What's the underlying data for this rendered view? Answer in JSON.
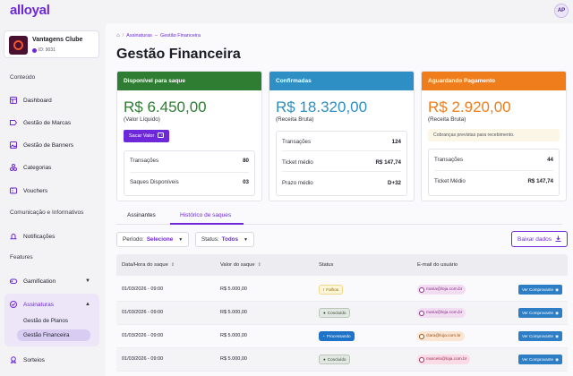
{
  "app": {
    "logo": "alloyal",
    "avatar_initials": "AP"
  },
  "club": {
    "name": "Vantagens Clube",
    "id": "ID: 9031"
  },
  "sidebar": {
    "sections": {
      "conteudo": "Conteúdo",
      "comunicacao": "Comunicação e Informativos",
      "features": "Features"
    },
    "items": [
      {
        "label": "Dashboard",
        "icon": "dashboard-icon"
      },
      {
        "label": "Gestão de Marcas",
        "icon": "tag-icon"
      },
      {
        "label": "Gestão de Banners",
        "icon": "image-icon"
      },
      {
        "label": "Categorias",
        "icon": "categories-icon"
      },
      {
        "label": "Vouchers",
        "icon": "voucher-icon"
      },
      {
        "label": "Notificações",
        "icon": "bell-icon"
      },
      {
        "label": "Gamification",
        "icon": "gamepad-icon"
      },
      {
        "label": "Assinaturas",
        "icon": "check-circle-icon"
      },
      {
        "label": "Sorteios",
        "icon": "award-icon"
      }
    ],
    "assinaturas_sub": [
      "Gestão de Planos",
      "Gestão Financeira"
    ]
  },
  "breadcrumb": {
    "parts": [
      "Assinaturas",
      "Gestão Financeira"
    ],
    "sep": "/",
    "inner_sep": "–"
  },
  "page_title": "Gestão Financeira",
  "cards": {
    "disponivel": {
      "title": "Disponível para saque",
      "amount": "R$ 6.450,00",
      "sub": "(Valor Líquido)",
      "button": "Sacar Valor",
      "rows": [
        {
          "label": "Transações",
          "value": "80"
        },
        {
          "label": "Saques Disponíveis",
          "value": "03"
        }
      ],
      "color": "#2e7d32"
    },
    "confirmadas": {
      "title": "Confirmadas",
      "amount": "R$ 18.320,00",
      "sub": "(Receita Bruta)",
      "rows": [
        {
          "label": "Transações",
          "value": "124"
        },
        {
          "label": "Ticket médio",
          "value": "R$ 147,74"
        },
        {
          "label": "Prazo médio",
          "value": "D+32"
        }
      ],
      "color": "#2d8fc4"
    },
    "aguardando": {
      "title": "Aguardando Pagamento",
      "amount": "R$ 2.920,00",
      "sub": "(Receita Bruta)",
      "notice": "Cobranças previstas para recebimento.",
      "rows": [
        {
          "label": "Transações",
          "value": "44"
        },
        {
          "label": "Ticket Médio",
          "value": "R$ 147,74"
        }
      ],
      "color": "#f07d1b"
    }
  },
  "tabs": [
    "Assinantes",
    "Histórico de saques"
  ],
  "filters": {
    "periodo": {
      "label": "Período:",
      "value": "Selecione"
    },
    "status": {
      "label": "Status:",
      "value": "Todos"
    },
    "download": "Baixar dados"
  },
  "table": {
    "headers": [
      "Data/Hora do saque",
      "Valor do saque",
      "Status",
      "E-mail do usuário"
    ],
    "rows": [
      {
        "date": "01/03/2026 - 09:00",
        "value": "R$ 5.000,00",
        "status": "Falhou",
        "status_type": "failed",
        "email": "maria@loja.com.br",
        "action": "Ver Comprovante"
      },
      {
        "date": "01/03/2026 - 09:00",
        "value": "R$ 5.000,00",
        "status": "Concluído",
        "status_type": "done",
        "email": "maria@loja.com.br",
        "action": "Ver Comprovante"
      },
      {
        "date": "01/03/2026 - 09:00",
        "value": "R$ 5.000,00",
        "status": "Processando",
        "status_type": "processing",
        "email": "clara@loja.com.br",
        "action": "Ver Comprovante"
      },
      {
        "date": "01/03/2026 - 09:00",
        "value": "R$ 5.000,00",
        "status": "Concluído",
        "status_type": "done",
        "email": "marcelo@loja.com.br",
        "action": "Ver Comprovante"
      }
    ]
  },
  "colors": {
    "accent": "#6d28d9",
    "green": "#2e7d32",
    "blue": "#2d8fc4",
    "orange": "#f07d1b"
  }
}
